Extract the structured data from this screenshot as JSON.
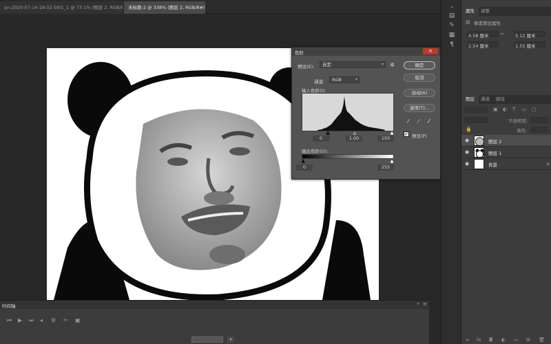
{
  "tabs": [
    {
      "label": "an-2020-07-14-18-32-59(1_1 @ 73.1% (图层 2, RGB/8)",
      "close": "×"
    },
    {
      "label": "未标题-2 @ 338% (图层 2, RGB/8#) *",
      "close": "×"
    }
  ],
  "levels_dialog": {
    "title": "色阶",
    "close": "×",
    "preset_label": "预设(E):",
    "preset_value": "自定",
    "channel_label": "通道:",
    "channel_value": "RGB",
    "input_levels_label": "输入色阶(I):",
    "input_values": [
      "0",
      "1.00",
      "150"
    ],
    "output_levels_label": "输出色阶(O):",
    "output_values": [
      "0",
      "255"
    ],
    "buttons": {
      "ok": "确定",
      "cancel": "取消",
      "auto": "自动(A)",
      "options": "选项(T)..."
    },
    "preview_label": "预览(P)",
    "preview_checked": true,
    "histogram": [
      2,
      2,
      3,
      3,
      4,
      5,
      6,
      7,
      8,
      9,
      11,
      13,
      15,
      17,
      20,
      24,
      27,
      31,
      34,
      38,
      41,
      44,
      47,
      52,
      60,
      72,
      95,
      70,
      58,
      52,
      50,
      47,
      44,
      41,
      38,
      35,
      32,
      29,
      27,
      25,
      23,
      21,
      19,
      18,
      16,
      15,
      14,
      13,
      12,
      11,
      10,
      10,
      9,
      9,
      8,
      8,
      7,
      7,
      6,
      6,
      5,
      5,
      4,
      4,
      3,
      3
    ]
  },
  "timeline": {
    "title": "时间轴"
  },
  "properties": {
    "tabs": [
      "属性",
      "调整"
    ],
    "subtitle": "像素图层属性",
    "w": "4.58 厘米",
    "h": "5.12 厘米",
    "x": "2.54 厘米",
    "y": "1.55 厘米"
  },
  "layers_panel": {
    "tabs": [
      "图层",
      "通道",
      "路径"
    ],
    "opacity_label": "不透明度:",
    "fill_label": "填充:",
    "layers": [
      {
        "name": "图层 2",
        "selected": true,
        "locked": false
      },
      {
        "name": "图层 1",
        "selected": false,
        "locked": false
      },
      {
        "name": "背景",
        "selected": false,
        "locked": true
      }
    ]
  }
}
